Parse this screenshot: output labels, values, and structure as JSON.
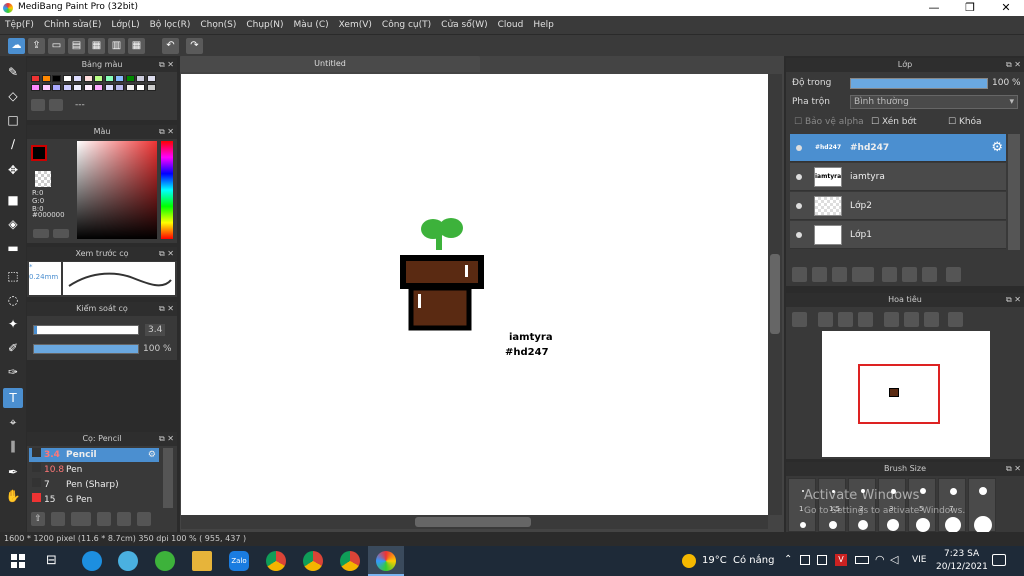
{
  "title": "MediBang Paint Pro (32bit)",
  "window_buttons": {
    "minimize": "—",
    "maximize": "❐",
    "close": "✕"
  },
  "menu": [
    "Tệp(F)",
    "Chỉnh sửa(E)",
    "Lớp(L)",
    "Bộ lọc(R)",
    "Chọn(S)",
    "Chụp(N)",
    "Màu (C)",
    "Xem(V)",
    "Công cụ(T)",
    "Cửa sổ(W)",
    "Cloud",
    "Help"
  ],
  "doc_tab": "Untitled",
  "panels": {
    "palette": {
      "title": "Bảng màu",
      "label": "---"
    },
    "color": {
      "title": "Màu",
      "r": "R:0",
      "g": "G:0",
      "b": "B:0",
      "hex": "#000000"
    },
    "brush_preview": {
      "title": "Xem trước cọ",
      "size": "* 0.24mm"
    },
    "brush_control": {
      "title": "Kiểm soát cọ",
      "size": "3.4",
      "opacity": "100 %"
    },
    "brushes": {
      "title": "Cọ: Pencil",
      "items": [
        {
          "size": "3.4",
          "name": "Pencil"
        },
        {
          "size": "10.8",
          "name": "Pen"
        },
        {
          "size": "7",
          "name": "Pen (Sharp)"
        },
        {
          "size": "15",
          "name": "G Pen"
        }
      ]
    },
    "layers": {
      "title": "Lớp",
      "opacity_label": "Độ trong",
      "opacity_value": "100 %",
      "blend_label": "Pha trộn",
      "blend_value": "Bình thường",
      "protect_alpha": "Bảo vệ alpha",
      "clipping": "Xén bớt",
      "lock": "Khóa",
      "items": [
        {
          "thumb": "#hd247",
          "name": "#hd247"
        },
        {
          "thumb": "iamtyra",
          "name": "iamtyra"
        },
        {
          "thumb": "",
          "name": "Lớp2"
        },
        {
          "thumb": "",
          "name": "Lớp1"
        }
      ]
    },
    "navigator": {
      "title": "Hoa tiêu"
    },
    "brush_size": {
      "title": "Brush Size",
      "values": [
        "1",
        "1.5",
        "2",
        "3",
        "5",
        "7"
      ],
      "watermark_title": "Activate Windows",
      "watermark_sub": "Go to Settings to activate Windows."
    }
  },
  "canvas_text": {
    "line1": "iamtyra",
    "line2": "#hd247"
  },
  "status": "1600 * 1200 pixel  (11.6 * 8.7cm)  350 dpi  100 %  ( 955, 437 )",
  "taskbar": {
    "weather_temp": "19°C",
    "weather_text": "Có nắng",
    "lang": "VIE",
    "time": "7:23 SA",
    "date": "20/12/2021",
    "zalo": "Zalo"
  },
  "colors": {
    "accent": "#4b8fd0",
    "panel": "#393939",
    "plant_green": "#3db23b",
    "pot_brown": "#5a2a12"
  }
}
